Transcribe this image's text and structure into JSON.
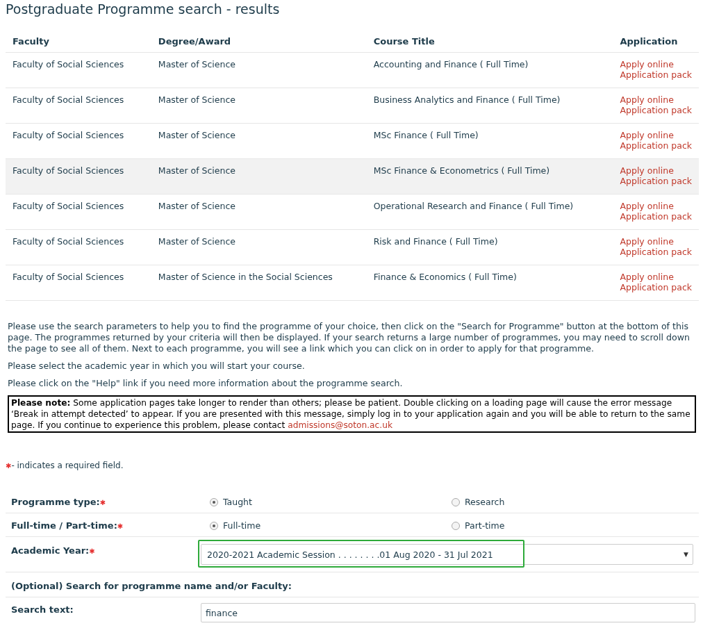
{
  "page_title": "Postgraduate Programme search - results",
  "table": {
    "columns": [
      "Faculty",
      "Degree/Award",
      "Course Title",
      "Application"
    ],
    "rows": [
      {
        "faculty": "Faculty of Social Sciences",
        "degree": "Master of Science",
        "course": "Accounting and Finance ( Full Time)",
        "links": [
          "Apply online",
          "Application pack"
        ],
        "highlighted": false
      },
      {
        "faculty": "Faculty of Social Sciences",
        "degree": "Master of Science",
        "course": "Business Analytics and Finance ( Full Time)",
        "links": [
          "Apply online",
          "Application pack"
        ],
        "highlighted": false
      },
      {
        "faculty": "Faculty of Social Sciences",
        "degree": "Master of Science",
        "course": "MSc Finance ( Full Time)",
        "links": [
          "Apply online",
          "Application pack"
        ],
        "highlighted": false
      },
      {
        "faculty": "Faculty of Social Sciences",
        "degree": "Master of Science",
        "course": "MSc Finance & Econometrics ( Full Time)",
        "links": [
          "Apply online",
          "Application pack"
        ],
        "highlighted": true
      },
      {
        "faculty": "Faculty of Social Sciences",
        "degree": "Master of Science",
        "course": "Operational Research and Finance ( Full Time)",
        "links": [
          "Apply online",
          "Application pack"
        ],
        "highlighted": false
      },
      {
        "faculty": "Faculty of Social Sciences",
        "degree": "Master of Science",
        "course": "Risk and Finance ( Full Time)",
        "links": [
          "Apply online",
          "Application pack"
        ],
        "highlighted": false
      },
      {
        "faculty": "Faculty of Social Sciences",
        "degree": "Master of Science in the Social Sciences",
        "course": "Finance & Economics ( Full Time)",
        "links": [
          "Apply online",
          "Application pack"
        ],
        "highlighted": false
      }
    ]
  },
  "paragraphs": [
    "Please use the search parameters to help you to find the programme of your choice, then click on the \"Search for Programme\" button at the bottom of this page. The programmes returned by your criteria will then be displayed. If your search returns a large number of programmes, you may need to scroll down the page to see all of them. Next to each programme, you will see a link which you can click on in order to apply for that programme.",
    "Please select the academic year in which you will start your course.",
    "Please click on the \"Help\" link if you need more information about the programme search."
  ],
  "note": {
    "text": "**Please note:** Some application pages take longer to render than others; please be patient. Double clicking on a loading page will cause the error message ‘Break in attempt detected’ to appear. If you are presented with this message, simply log in to your application again and you will be able to return to the same page. If you continue to experience this problem, please contact",
    "email": "admissions@soton.ac.uk"
  },
  "required_legend": {
    "mark": "✱",
    "text": " - indicates a required field."
  },
  "form": [
    {
      "kind": "radio",
      "label": "Programme type:",
      "required": true,
      "options": [
        {
          "label": "Taught",
          "selected": true
        },
        {
          "label": "Research",
          "selected": false
        }
      ]
    },
    {
      "kind": "radio",
      "label": "Full-time / Part-time:",
      "required": true,
      "options": [
        {
          "label": "Full-time",
          "selected": true
        },
        {
          "label": "Part-time",
          "selected": false
        }
      ]
    },
    {
      "kind": "select",
      "label": "Academic Year:",
      "required": true,
      "value": "2020-2021 Academic Session . . . . . . . .01 Aug 2020 - 31 Jul 2021",
      "caret": "▼",
      "highlighted": true
    },
    {
      "kind": "heading",
      "label": "(Optional) Search for programme name and/or Faculty:",
      "required": false
    },
    {
      "kind": "text",
      "label": "Search text:",
      "required": false,
      "value": "finance"
    }
  ]
}
